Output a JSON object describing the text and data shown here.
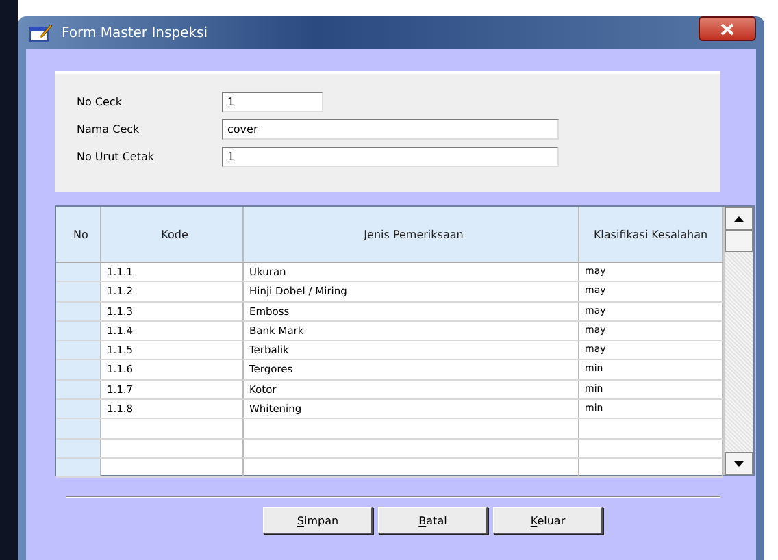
{
  "window": {
    "title": "Form Master Inspeksi"
  },
  "fields": [
    {
      "label": "No Ceck",
      "value": "1",
      "kind": "short"
    },
    {
      "label": "Nama Ceck",
      "value": "cover",
      "kind": "long"
    },
    {
      "label": "No Urut Cetak",
      "value": "1",
      "kind": "long"
    }
  ],
  "table": {
    "columns": [
      "No",
      "Kode",
      "Jenis Pemeriksaan",
      "Klasifikasi Kesalahan"
    ],
    "rows": [
      {
        "kode": "1.1.1",
        "jenis": "Ukuran",
        "klasifikasi": "may"
      },
      {
        "kode": "1.1.2",
        "jenis": "Hinji Dobel / Miring",
        "klasifikasi": "may"
      },
      {
        "kode": "1.1.3",
        "jenis": "Emboss",
        "klasifikasi": "may"
      },
      {
        "kode": "1.1.4",
        "jenis": "Bank Mark",
        "klasifikasi": "may"
      },
      {
        "kode": "1.1.5",
        "jenis": "Terbalik",
        "klasifikasi": "may"
      },
      {
        "kode": "1.1.6",
        "jenis": "Tergores",
        "klasifikasi": "min"
      },
      {
        "kode": "1.1.7",
        "jenis": "Kotor",
        "klasifikasi": "min"
      },
      {
        "kode": "1.1.8",
        "jenis": "Whitening",
        "klasifikasi": "min"
      }
    ]
  },
  "buttons": [
    {
      "label": "Simpan",
      "mnemonic_underlined": true
    },
    {
      "label": "Batal",
      "mnemonic_underlined": true
    },
    {
      "label": "Keluar",
      "mnemonic_underlined": true
    }
  ]
}
